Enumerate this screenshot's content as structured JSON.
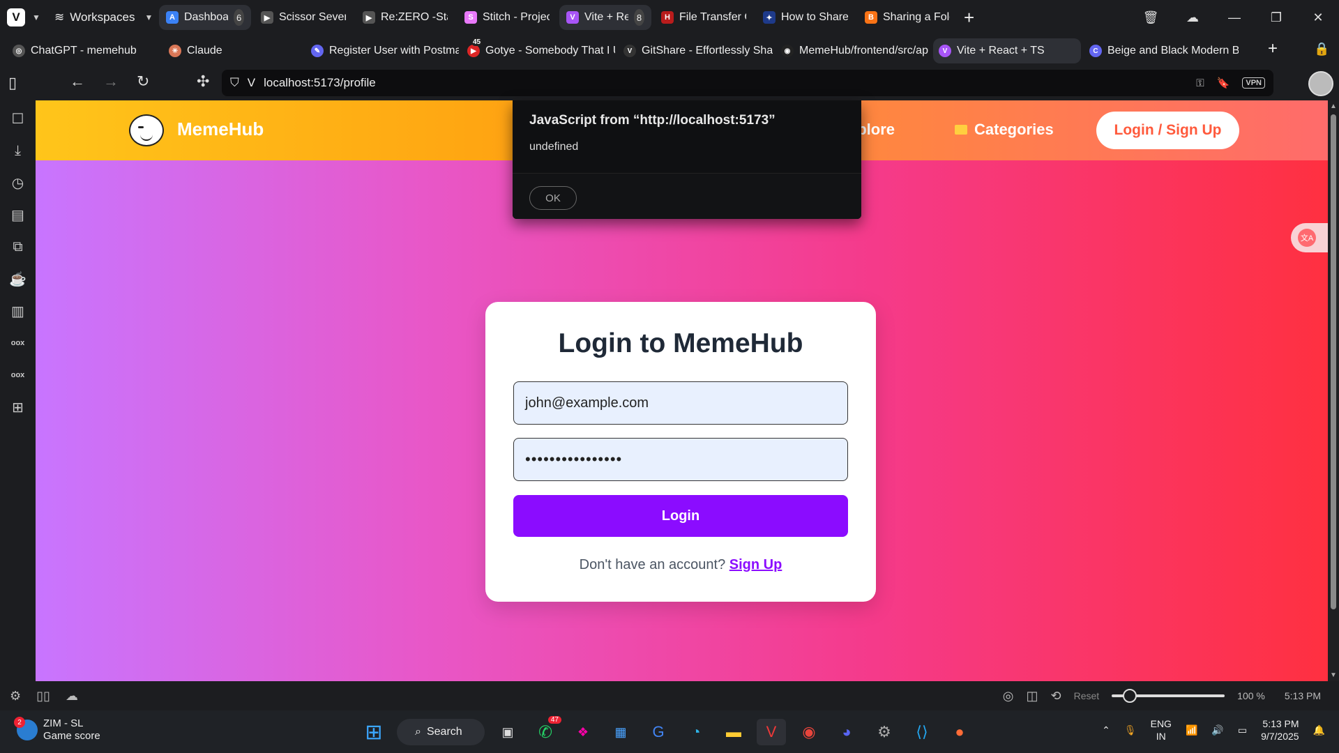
{
  "browser": {
    "workspaces_label": "Workspaces",
    "tabs": [
      {
        "title": "Dashboard | G",
        "count": "6",
        "color": "#3b82f6",
        "glyph": "A"
      },
      {
        "title": "Scissor Seven Episo",
        "color": "#555",
        "glyph": "▶"
      },
      {
        "title": "Re:ZERO -Starting",
        "color": "#555",
        "glyph": "▶"
      },
      {
        "title": "Stitch - Projects",
        "color": "#e879f9",
        "glyph": "S"
      },
      {
        "title": "Vite + React +",
        "count": "8",
        "color": "#a855f7",
        "glyph": "V"
      },
      {
        "title": "File Transfer Cheat",
        "color": "#b91c1c",
        "glyph": "H"
      },
      {
        "title": "How to Share File",
        "color": "#1e3a8a",
        "glyph": "✦"
      },
      {
        "title": "Sharing a Folder or",
        "color": "#f97316",
        "glyph": "B"
      }
    ],
    "bookmarks": [
      {
        "title": "ChatGPT - memehub",
        "color": "#555",
        "glyph": "◎"
      },
      {
        "title": "Claude",
        "color": "#d97757",
        "glyph": "✳"
      },
      {
        "title": "Register User with Postman",
        "color": "#6366f1",
        "glyph": "✎"
      },
      {
        "title": "Gotye - Somebody That I U",
        "color": "#dc2626",
        "glyph": "▶",
        "badge": "45"
      },
      {
        "title": "GitShare - Effortlessly Share",
        "color": "#333",
        "glyph": "V"
      },
      {
        "title": "MemeHub/frontend/src/ap",
        "color": "#222",
        "glyph": "◉"
      },
      {
        "title": "Vite + React + TS",
        "color": "#a855f7",
        "glyph": "V"
      },
      {
        "title": "Beige and Black Modern Be",
        "color": "#6366f1",
        "glyph": "C"
      }
    ],
    "url": "localhost:5173/profile",
    "vpn_label": "VPN"
  },
  "page": {
    "brand": "MemeHub",
    "nav_explore": "xplore",
    "nav_categories": "Categories",
    "nav_login": "Login / Sign Up",
    "login_title": "Login to MemeHub",
    "email_value": "john@example.com",
    "password_value": "••••••••••••••••",
    "login_button": "Login",
    "signup_prompt": "Don't have an account?",
    "signup_link": "Sign Up",
    "translate_glyph": "文A"
  },
  "alert": {
    "title": "JavaScript from “http://localhost:5173”",
    "message": "undefined",
    "ok": "OK"
  },
  "statusbar": {
    "reset": "Reset",
    "zoom": "100 %",
    "zoom_level": 0.16,
    "time": "5:13 PM"
  },
  "taskbar": {
    "weather_badge": "2",
    "weather_line1": "ZIM - SL",
    "weather_line2": "Game score",
    "search": "Search",
    "whatsapp_badge": "47",
    "lang_line1": "ENG",
    "lang_line2": "IN",
    "clock_time": "5:13 PM",
    "clock_date": "9/7/2025"
  }
}
